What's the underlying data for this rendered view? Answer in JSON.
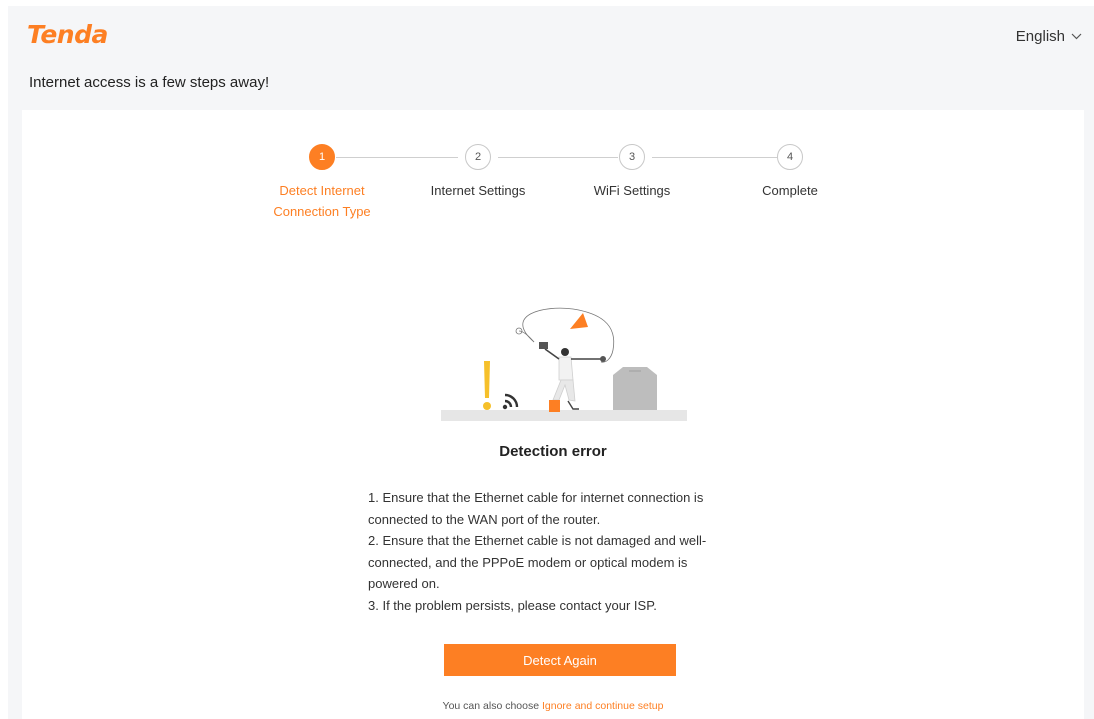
{
  "brand": {
    "logo_text": "Tenda",
    "accent": "#fd7f23"
  },
  "header": {
    "language": "English",
    "subtitle": "Internet access is a few steps away!"
  },
  "steps": [
    {
      "number": "1",
      "label": "Detect Internet Connection Type",
      "state": "active"
    },
    {
      "number": "2",
      "label": "Internet Settings",
      "state": "idle"
    },
    {
      "number": "3",
      "label": "WiFi Settings",
      "state": "idle"
    },
    {
      "number": "4",
      "label": "Complete",
      "state": "idle"
    }
  ],
  "error": {
    "title": "Detection error",
    "lines": [
      "1. Ensure that the Ethernet cable for internet connection is connected to the WAN port of the router.",
      "2. Ensure that the Ethernet cable is not damaged and well-connected, and the PPPoE modem or optical modem is powered on.",
      "3. If the problem persists, please contact your ISP."
    ]
  },
  "actions": {
    "detect_again": "Detect Again",
    "alt_prefix": "You can also choose",
    "alt_link": "Ignore and continue setup"
  },
  "icons": {
    "language_chevron": "chevron-down-icon",
    "illustration": "detection-error-illustration"
  }
}
